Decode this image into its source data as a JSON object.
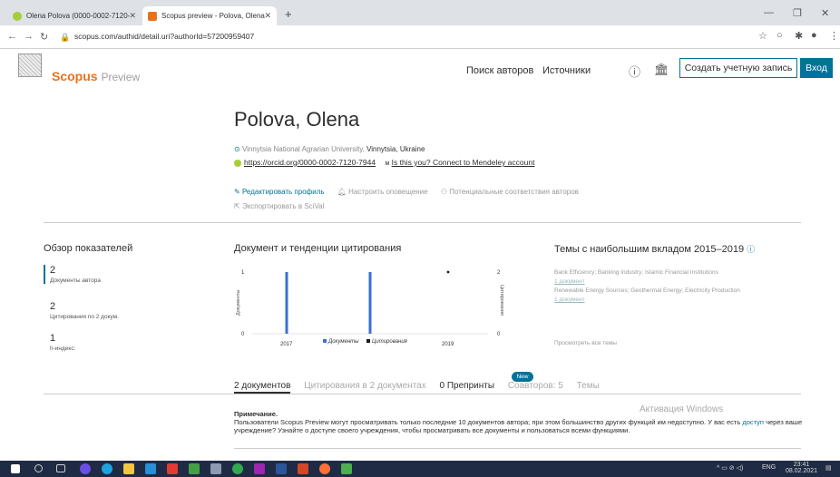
{
  "browser": {
    "tabs": [
      {
        "title": "Olena Polova (0000-0002-7120-"
      },
      {
        "title": "Scopus preview - Polova, Olena"
      }
    ],
    "new_tab": "+",
    "url": "scopus.com/authid/detail.uri?authorId=57200959407"
  },
  "header": {
    "logo_main": "Scopus",
    "logo_sub": "Preview",
    "nav": [
      "Поиск авторов",
      "Источники"
    ],
    "create_account": "Создать учетную запись",
    "login": "Вход"
  },
  "author": {
    "name": "Polova, Olena",
    "affiliation": "Vinnytsia National Agrarian University,",
    "location": "Vinnytsia, Ukraine",
    "orcid": "https://orcid.org/0000-0002-7120-7944",
    "mendeley": "Is this you? Connect to Mendeley account",
    "actions": [
      "Редактировать профиль",
      "Настроить оповещение",
      "Потенциальные соответствия авторов"
    ],
    "export": "Экспортировать в SciVal"
  },
  "metrics": {
    "title": "Обзор показателей",
    "items": [
      {
        "value": "2",
        "label": "Документы автора"
      },
      {
        "value": "2",
        "label": "Цитирования по 2 докум."
      },
      {
        "value": "1",
        "label": "h-индекс:"
      }
    ]
  },
  "trends_title": "Документ и тенденции цитирования",
  "chart_data": {
    "type": "bar",
    "title": "Документ и тенденции цитирования",
    "categories": [
      "2017",
      "2018",
      "2019"
    ],
    "series": [
      {
        "name": "Документы",
        "values": [
          1,
          1,
          0
        ],
        "color": "#3b6fd6"
      },
      {
        "name": "Цитирования",
        "values": [
          null,
          null,
          2
        ],
        "color": "#1a1a1a"
      }
    ],
    "ylabel_left": "Документы",
    "ylabel_right": "Цитирования",
    "yleft_ticks": [
      "0",
      "1"
    ],
    "yright_ticks": [
      "0",
      "2"
    ],
    "xticks": [
      "2017",
      "2019"
    ],
    "legend": "bottom"
  },
  "topics": {
    "title": "Темы с наибольшим вкладом 2015–2019",
    "items": [
      {
        "text": "Bank Efficiency; Banking Industry; Islamic Financial Institutions",
        "count": "1 документ"
      },
      {
        "text": "Renewable Energy Sources; Geothermal Energy; Electricity Production",
        "count": "1 документ"
      }
    ],
    "view_all": "Просмотреть все темы"
  },
  "tabs": [
    "2 документов",
    "Цитирования в 2 документах",
    "0 Препринты",
    "Соавторов: 5",
    "Темы"
  ],
  "new_badge": "New",
  "note": {
    "title": "Примечание.",
    "text1": "Пользователи Scopus Preview могут просматривать только последние 10 документов автора; при этом большинство других функций им недоступно. У вас есть",
    "link": "доступ",
    "text2": "через ваше учреждение? Узнайте о доступе своего учреждения, чтобы просматривать все документы и пользоваться всеми функциями."
  },
  "watermark": "Активация Windows",
  "taskbar": {
    "lang": "ENG",
    "time": "23:41",
    "date": "08.02.2021"
  }
}
